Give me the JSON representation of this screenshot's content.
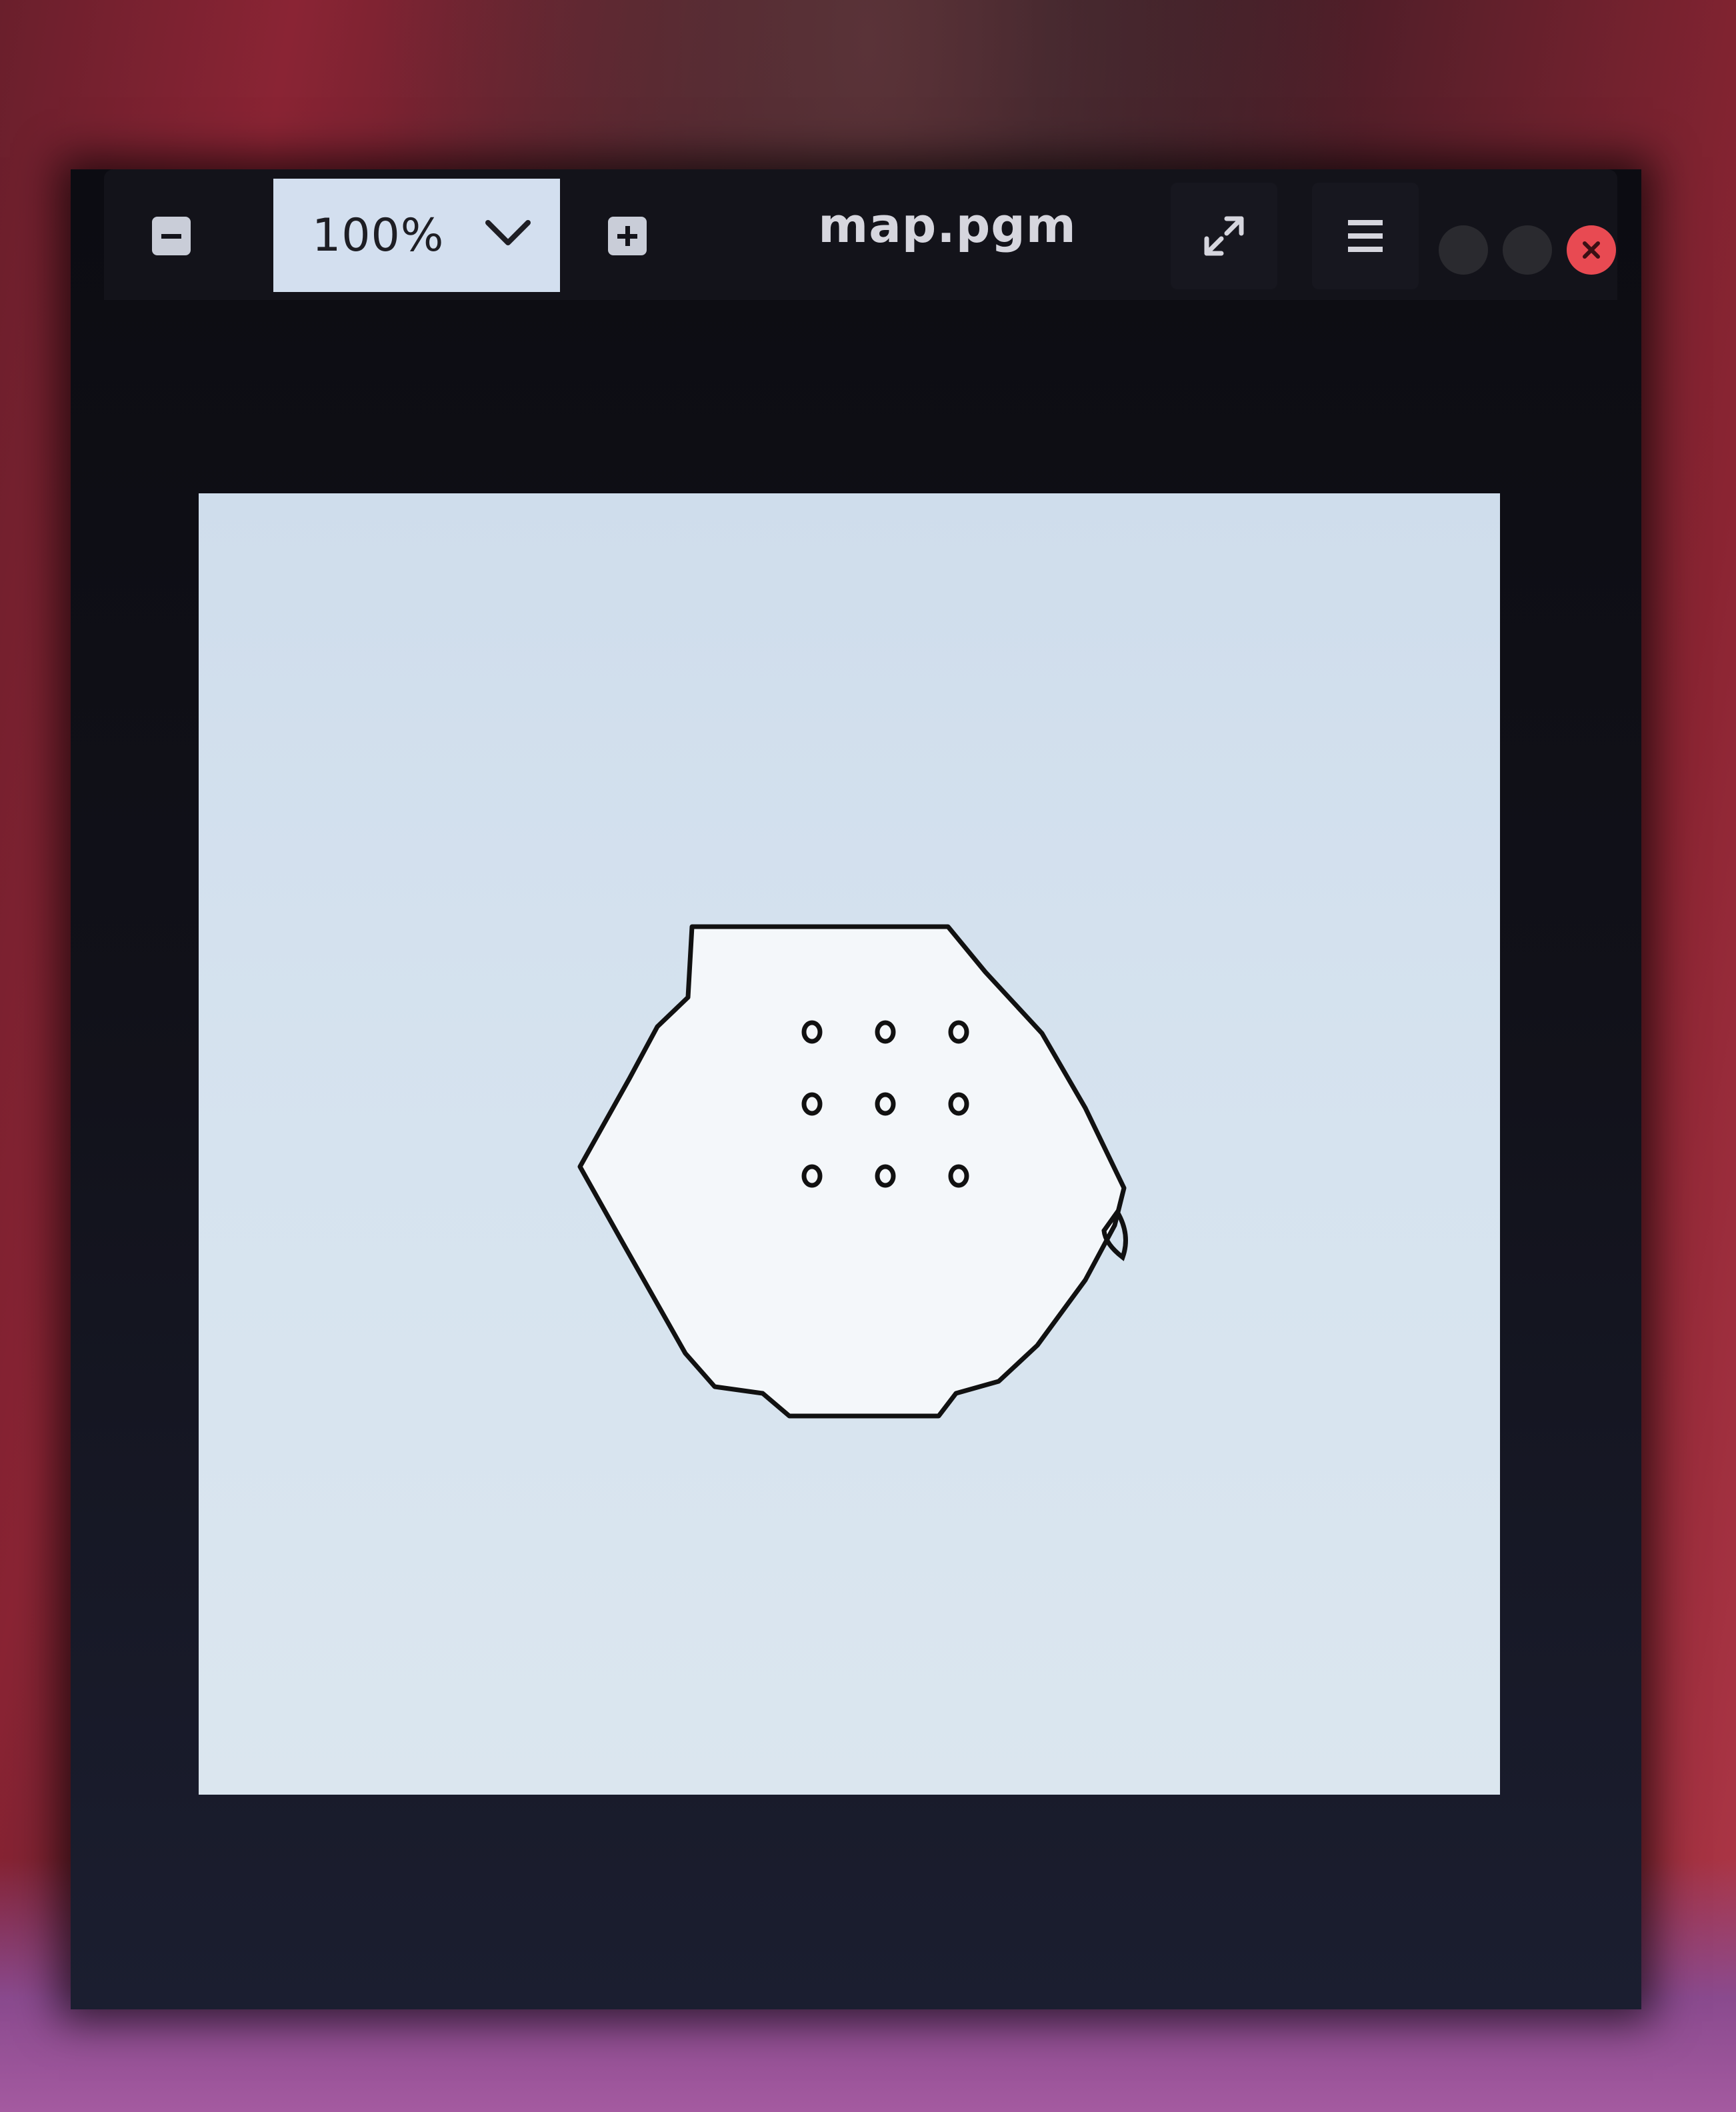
{
  "window": {
    "title": "map.pgm"
  },
  "toolbar": {
    "zoom_level": "100%",
    "zoom_out_icon": "minus-square-icon",
    "zoom_in_icon": "plus-square-icon",
    "zoom_dropdown_icon": "chevron-down-icon",
    "fullscreen_icon": "fullscreen-icon",
    "menu_icon": "hamburger-menu-icon"
  },
  "window_controls": {
    "minimize_icon": "minimize-icon",
    "maximize_icon": "maximize-icon",
    "close_icon": "close-icon",
    "close_color": "#e84a52"
  },
  "image": {
    "background_color": "#d6e3ef",
    "line_color": "#111111",
    "obstacles": {
      "rows": 3,
      "cols": 3
    }
  }
}
